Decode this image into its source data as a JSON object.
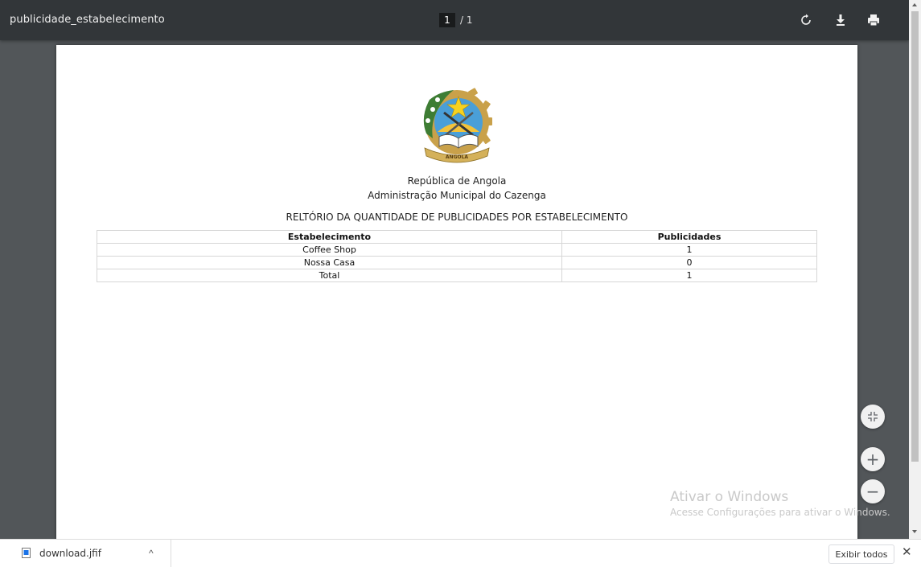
{
  "toolbar": {
    "title": "publicidade_estabelecimento",
    "current_page": "1",
    "page_separator": "/ 1",
    "rotate_icon": "rotate-icon",
    "download_icon": "download-icon",
    "print_icon": "print-icon"
  },
  "document": {
    "emblem": "angola-emblem",
    "emblem_text": "ANGOLA",
    "republic": "República de Angola",
    "administration": "Administração Municipal do Cazenga",
    "report_title": "RELTÓRIO DA QUANTIDADE DE PUBLICIDADES POR ESTABELECIMENTO",
    "table": {
      "headers": [
        "Estabelecimento",
        "Publicidades"
      ],
      "rows": [
        [
          "Coffee Shop",
          "1"
        ],
        [
          "Nossa Casa",
          "0"
        ],
        [
          "Total",
          "1"
        ]
      ]
    }
  },
  "zoom": {
    "fit_icon": "fit-to-page-icon",
    "zoom_in": "+",
    "zoom_out": "−"
  },
  "watermark": {
    "line1": "Ativar o Windows",
    "line2": "Acesse Configurações para ativar o Windows."
  },
  "download_bar": {
    "file_name": "download.jfif",
    "chevron": "^",
    "show_all": "Exibir todos",
    "close": "✕"
  }
}
